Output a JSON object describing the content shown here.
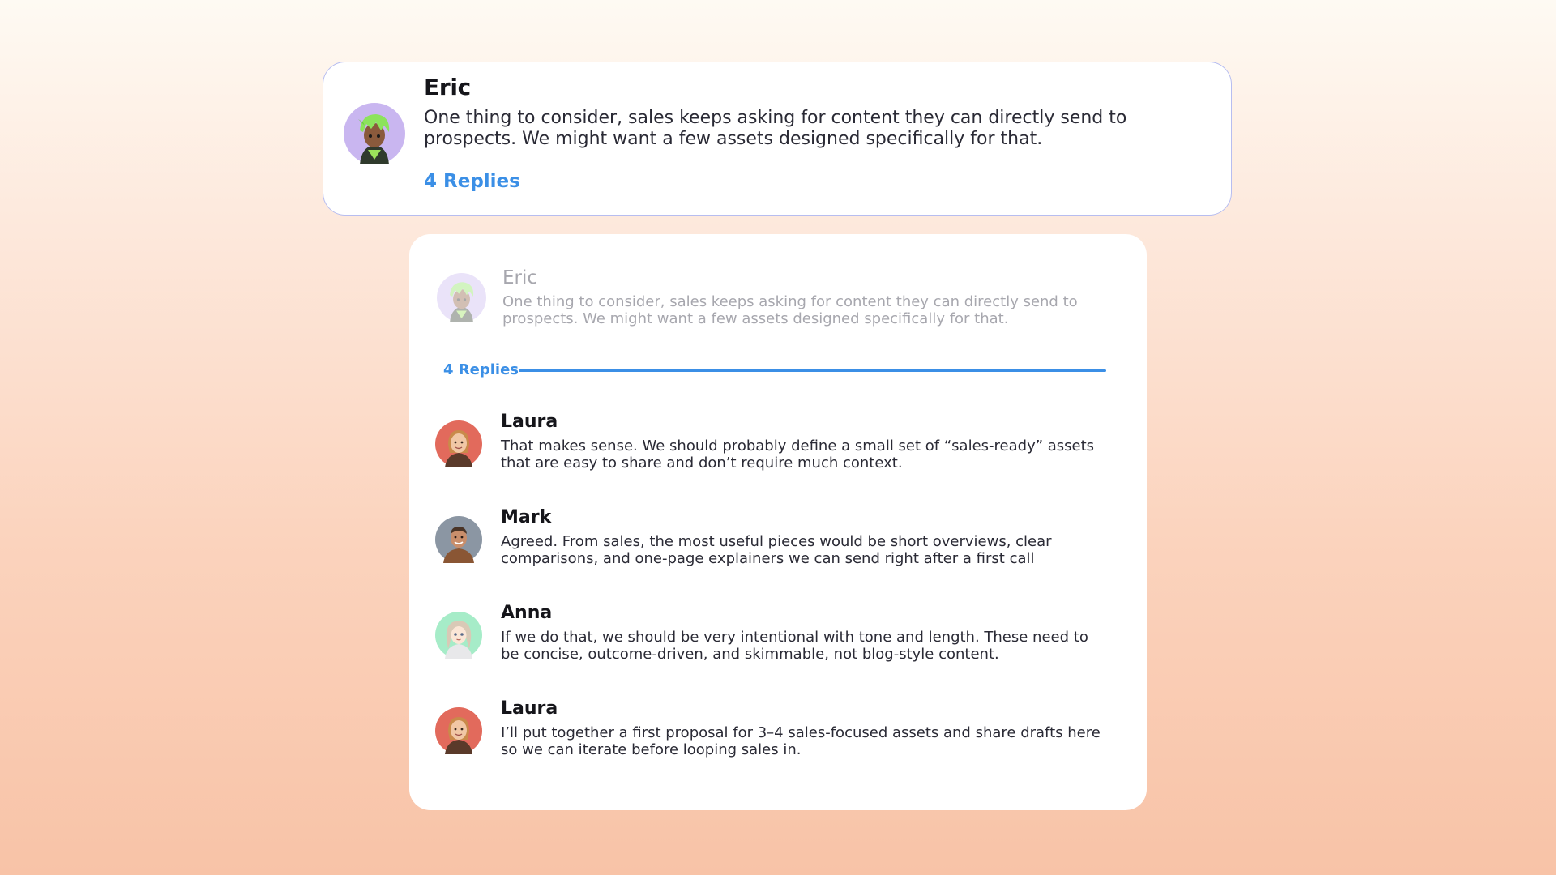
{
  "original_message": {
    "author": "Eric",
    "text": "One thing to consider, sales keeps asking for content they can directly send to prospects. We might want a few assets designed specifically for that.",
    "replies_label": "4 Replies"
  },
  "thread": {
    "parent": {
      "author": "Eric",
      "text": "One thing to consider, sales keeps asking for content they can directly send to prospects. We might want a few assets designed specifically for that."
    },
    "replies_label": "4 Replies",
    "replies": [
      {
        "author": "Laura",
        "text": "That makes sense. We should probably define a small set of “sales-ready” assets that are easy to share and don’t require much context."
      },
      {
        "author": "Mark",
        "text": "Agreed. From sales, the most useful pieces would be short overviews, clear comparisons, and one-page explainers we can send right after a first call"
      },
      {
        "author": "Anna",
        "text": "If we do that, we should be very intentional with tone and length. These need to be concise, outcome-driven, and skimmable, not blog-style content."
      },
      {
        "author": "Laura",
        "text": "I’ll put together a first proposal for 3–4 sales-focused assets and share drafts here so we can iterate before looping sales in."
      }
    ]
  },
  "colors": {
    "accent_blue": "#3b8fe6",
    "card_border": "#b7bdf0",
    "muted_text": "#a7a7ae"
  },
  "icons": {
    "eric_avatar": "green-haired-character-avatar",
    "laura_avatar": "woman-portrait-avatar",
    "mark_avatar": "man-portrait-avatar",
    "anna_avatar": "anime-girl-avatar"
  }
}
